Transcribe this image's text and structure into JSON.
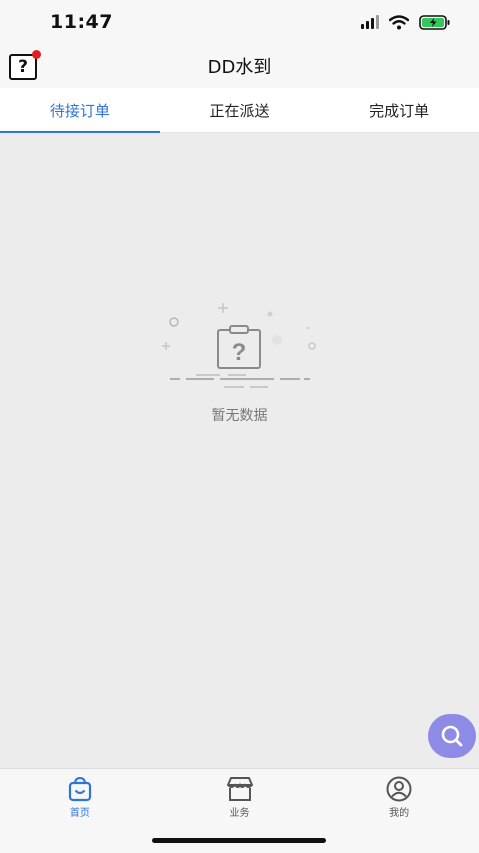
{
  "status_bar": {
    "time": "11:47"
  },
  "nav": {
    "title": "DD水到"
  },
  "tabs": [
    {
      "label": "待接订单",
      "active": true
    },
    {
      "label": "正在派送",
      "active": false
    },
    {
      "label": "完成订单",
      "active": false
    }
  ],
  "empty_state": {
    "text": "暂无数据",
    "icon": "clipboard-question-icon"
  },
  "fab": {
    "icon": "search-icon"
  },
  "bottom_nav": [
    {
      "label": "首页",
      "icon": "shopping-bag-icon",
      "active": true
    },
    {
      "label": "业务",
      "icon": "store-icon",
      "active": false
    },
    {
      "label": "我的",
      "icon": "profile-icon",
      "active": false
    }
  ],
  "colors": {
    "accent": "#2f74d8",
    "fab": "#8d8be6",
    "badge": "#e02020",
    "background": "#ececec"
  }
}
